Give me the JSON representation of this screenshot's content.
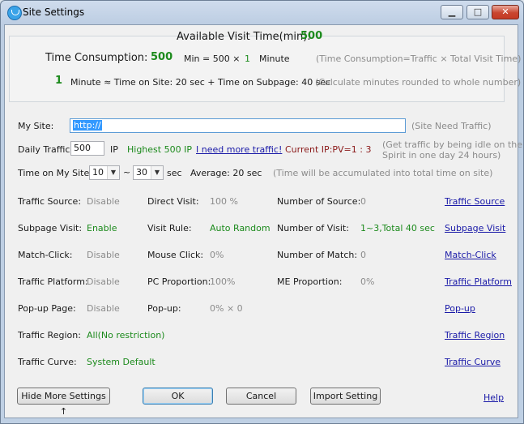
{
  "window": {
    "title": "Site Settings"
  },
  "summary": {
    "available_label": "Available Visit Time(min):",
    "available_value": "500",
    "consumption_label": "Time Consumption:",
    "consumption_value": "500",
    "formula_left": "Min = 500 ×",
    "formula_num": "1",
    "formula_right": "Minute",
    "formula_note": "(Time Consumption=Traffic × Total Visit Time)",
    "minute_num": "1",
    "minute_text": "Minute ≈ Time on Site: 20 sec + Time on Subpage: 40 sec",
    "minute_note": "(Calculate minutes rounded to whole number)"
  },
  "site": {
    "label": "My Site:",
    "value": "http://",
    "note": "(Site Need Traffic)"
  },
  "daily": {
    "label": "Daily Traffic:",
    "value": "500",
    "unit": "IP",
    "highest": "Highest 500 IP",
    "more_link": "I need more traffic!",
    "current": "Current IP:PV=1 : 3",
    "note_line1": "(Get traffic by being idle on the",
    "note_line2": "Spirit in one day 24 hours)"
  },
  "time": {
    "label": "Time on My Site:",
    "from": "10",
    "tilde": "~",
    "to": "30",
    "unit": "sec",
    "average": "Average: 20 sec",
    "note": "(Time will be accumulated into total time on site)"
  },
  "settings": [
    {
      "c1_label": "Traffic Source:",
      "c1_value": "Disable",
      "c2_label": "Direct Visit:",
      "c2_value": "100 %",
      "c3_label": "Number of Source:",
      "c3_value": "0",
      "link": "Traffic Source"
    },
    {
      "c1_label": "Subpage Visit:",
      "c1_value": "Enable",
      "c2_label": "Visit Rule:",
      "c2_value": "Auto Random",
      "c3_label": "Number of Visit:",
      "c3_value": "1~3,Total 40 sec",
      "link": "Subpage Visit"
    },
    {
      "c1_label": "Match-Click:",
      "c1_value": "Disable",
      "c2_label": "Mouse Click:",
      "c2_value": "0%",
      "c3_label": "Number of Match:",
      "c3_value": "0",
      "link": "Match-Click"
    },
    {
      "c1_label": "Traffic Platform:",
      "c1_value": "Disable",
      "c2_label": "PC Proportion:",
      "c2_value": "100%",
      "c3_label": "ME Proportion:",
      "c3_value": "0%",
      "link": "Traffic Platform"
    },
    {
      "c1_label": "Pop-up Page:",
      "c1_value": "Disable",
      "c2_label": "Pop-up:",
      "c2_value": "0% × 0",
      "c3_label": "",
      "c3_value": "",
      "link": "Pop-up"
    },
    {
      "c1_label": "Traffic Region:",
      "c1_value": "All(No restriction)",
      "c2_label": "",
      "c2_value": "",
      "c3_label": "",
      "c3_value": "",
      "link": "Traffic Region"
    },
    {
      "c1_label": "Traffic Curve:",
      "c1_value": "System Default",
      "c2_label": "",
      "c2_value": "",
      "c3_label": "",
      "c3_value": "",
      "link": "Traffic Curve"
    }
  ],
  "buttons": {
    "hide": "Hide More Settings ↑",
    "ok": "OK",
    "cancel": "Cancel",
    "import": "Import Setting",
    "help": "Help"
  },
  "colors": {
    "green": "#1c8a1c",
    "link": "#1a1aa8",
    "gray": "#8b8b8b"
  }
}
